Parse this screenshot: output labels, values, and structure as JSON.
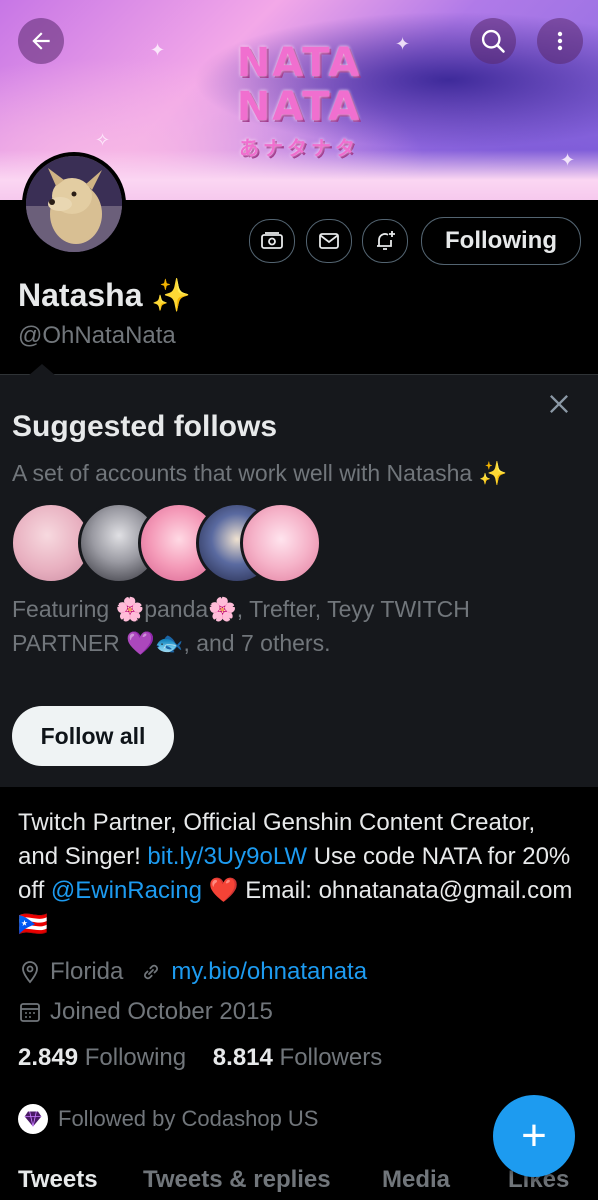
{
  "banner": {
    "logo_line1": "NATA",
    "logo_line2": "NATA",
    "logo_japanese": "あナタナタ"
  },
  "profile": {
    "name": "Natasha",
    "name_emoji": "✨",
    "handle": "@OhNataNata",
    "following_button": "Following"
  },
  "suggested": {
    "title": "Suggested follows",
    "subtitle": "A set of accounts that work well with Natasha ✨",
    "featuring": "Featuring 🌸panda🌸, Trefter, Teyy TWITCH PARTNER 💜🐟, and 7 others.",
    "follow_all_label": "Follow all"
  },
  "bio": {
    "text1": "Twitch Partner, Official Genshin Content Creator, and Singer! ",
    "link1": "bit.ly/3Uy9oLW",
    "text2": " Use code NATA for 20% off ",
    "mention": "@EwinRacing",
    "text3": " ❤️ Email: ohnatanata@gmail.com 🇵🇷"
  },
  "meta": {
    "location": "Florida",
    "website": "my.bio/ohnatanata",
    "joined": "Joined October 2015"
  },
  "stats": {
    "following_count": "2.849",
    "following_label": "Following",
    "followers_count": "8.814",
    "followers_label": "Followers"
  },
  "followed_by": "Followed by Codashop US",
  "tabs": [
    "Tweets",
    "Tweets & replies",
    "Media",
    "Likes"
  ],
  "fab_label": "+",
  "colors": {
    "accent": "#1d9bf0",
    "background": "#000000",
    "panel": "#16181c",
    "muted_text": "#71767b"
  },
  "icons": {
    "back": "arrow-left-icon",
    "search": "search-icon",
    "more": "more-vertical-icon",
    "tip": "money-icon",
    "message": "mail-icon",
    "notify": "bell-plus-icon",
    "close": "close-icon",
    "location": "location-pin-icon",
    "website": "link-icon",
    "calendar": "calendar-icon",
    "codashop": "gem-icon"
  }
}
